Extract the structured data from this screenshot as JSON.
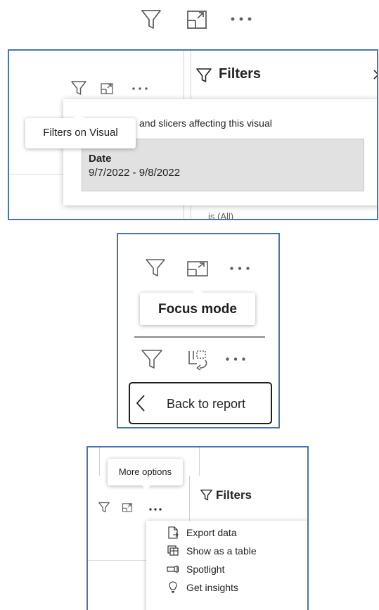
{
  "panel2": {
    "filters_title": "Filters",
    "tooltip": "Filters on Visual",
    "description": "and slicers affecting this visual",
    "filter_card": {
      "field": "Date",
      "value": "9/7/2022 - 9/8/2022"
    },
    "partial_text": "is (All)"
  },
  "panel3": {
    "tooltip": "Focus mode",
    "back_button": "Back to report"
  },
  "panel4": {
    "tooltip": "More options",
    "filters_title": "Filters",
    "menu": [
      {
        "label": "Export data",
        "icon": "export-data-icon"
      },
      {
        "label": "Show as a table",
        "icon": "show-as-table-icon"
      },
      {
        "label": "Spotlight",
        "icon": "spotlight-icon"
      },
      {
        "label": "Get insights",
        "icon": "lightbulb-icon"
      }
    ]
  },
  "colors": {
    "frame_blue": "#4a72b8",
    "icon_gray": "#605e5c",
    "filter_card_bg": "#e1e1e1",
    "back_button_border": "#201f1e"
  }
}
